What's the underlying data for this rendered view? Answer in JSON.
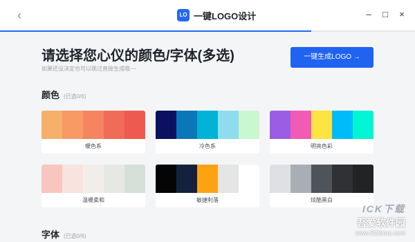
{
  "app": {
    "title": "一键LOGO设计",
    "logo_badge": "LO",
    "back_icon": "chevron-left-icon",
    "window_controls": [
      "×",
      "□",
      "×"
    ],
    "progress": 0.75
  },
  "header": {
    "heading": "请选择您心仪的颜色/字体(多选)",
    "subheading": "如果还没决定也可以跳过直接生成哦~~",
    "generate_button": "一键生成LOGO →"
  },
  "colors_section": {
    "title": "颜色",
    "count": "(已选0/6)"
  },
  "palettes": [
    {
      "label": "暖色系",
      "colors": [
        "#f5b06c",
        "#f79a64",
        "#f48560",
        "#f06c58",
        "#ee5a50"
      ]
    },
    {
      "label": "冷色系",
      "colors": [
        "#0b1060",
        "#0a77b8",
        "#00b3d6",
        "#8fdcee",
        "#c9f7d0"
      ]
    },
    {
      "label": "明亮色彩",
      "colors": [
        "#9b5de5",
        "#f15bb5",
        "#fee440",
        "#00bbf9",
        "#00f5d4"
      ]
    },
    {
      "label": "温暖柔和",
      "colors": [
        "#f8c6bf",
        "#f7e3df",
        "#f3edea",
        "#e6e8e4",
        "#d5e1d8"
      ]
    },
    {
      "label": "敏捷利落",
      "colors": [
        "#050505",
        "#14213d",
        "#fca311",
        "#e5e5e5",
        "#ffffff"
      ]
    },
    {
      "label": "炫酷黑白",
      "colors": [
        "#dee0e3",
        "#a9aeb5",
        "#4f535a",
        "#2f3135",
        "#222325"
      ]
    }
  ],
  "fonts_section": {
    "title": "字体",
    "count": "(已选0/6)"
  },
  "watermark": {
    "top": "ICK下载",
    "name": "吾爱软件园",
    "url": "www.52zixue.com"
  }
}
